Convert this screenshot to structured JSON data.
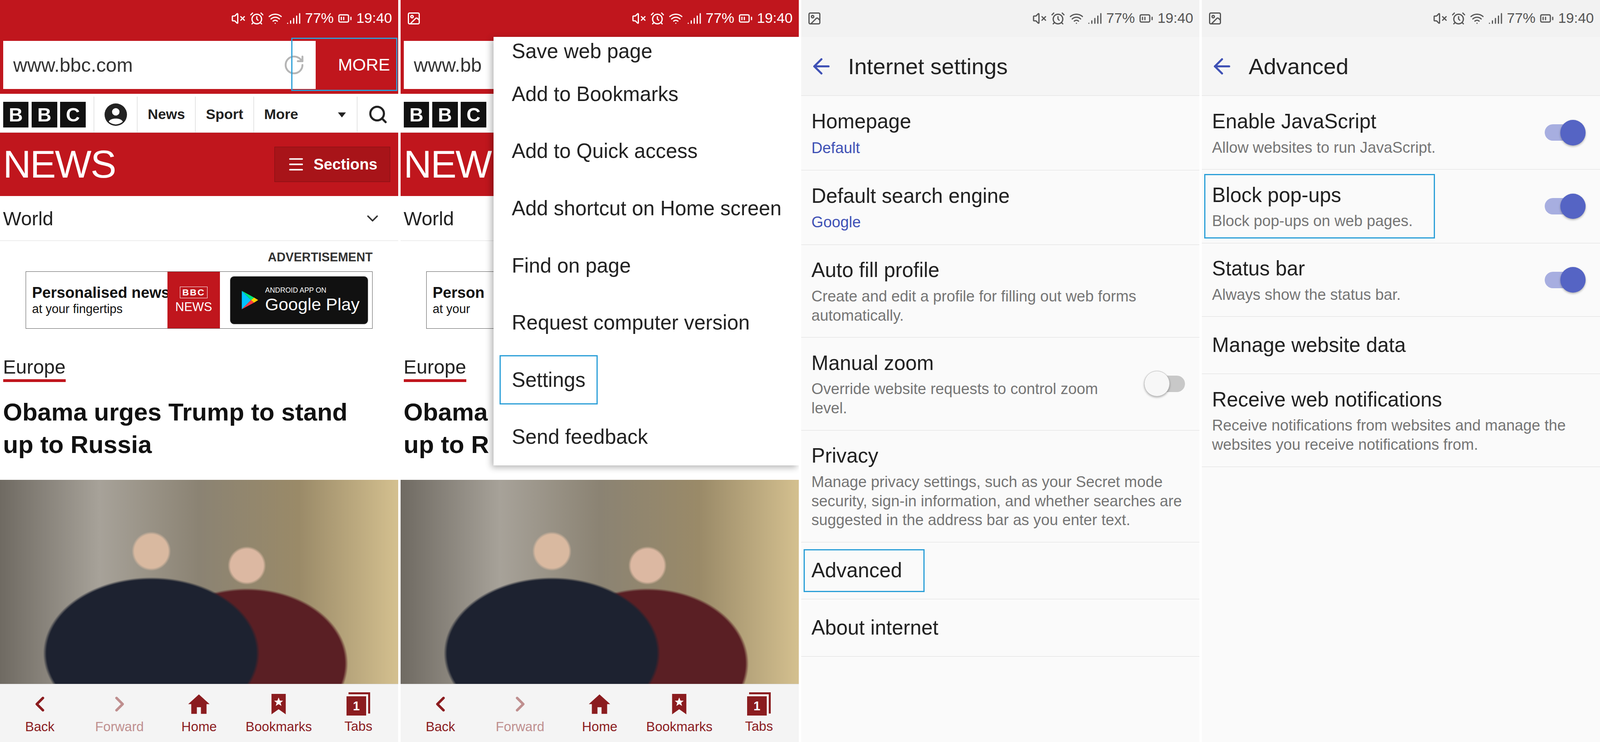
{
  "panels": [
    {
      "kind": "browser",
      "status": {
        "battery": "77%",
        "time": "19:40",
        "notification": false
      },
      "url": "www.bbc.com",
      "more": {
        "label": "MORE",
        "highlighted": true
      },
      "logo": [
        "B",
        "B",
        "C"
      ],
      "nav_links": [
        "News",
        "Sport",
        "More"
      ],
      "band": {
        "title": "NEWS",
        "button": "Sections"
      },
      "region": "World",
      "ad": {
        "label": "ADVERTISEMENT",
        "line1": "Personalised news",
        "line2": "at your fingertips",
        "brand": [
          "BBC",
          "NEWS"
        ],
        "store_small": "ANDROID APP ON",
        "store": "Google Play"
      },
      "category": "Europe",
      "headline": [
        "Obama urges Trump to stand",
        "up to Russia"
      ],
      "bottom_nav": [
        {
          "kind": "back",
          "label": "Back",
          "disabled": false
        },
        {
          "kind": "forward",
          "label": "Forward",
          "disabled": true
        },
        {
          "kind": "home",
          "label": "Home",
          "disabled": false
        },
        {
          "kind": "bookmarks",
          "label": "Bookmarks",
          "disabled": false
        },
        {
          "kind": "tabs",
          "label": "Tabs",
          "badge": "1",
          "disabled": false
        }
      ]
    },
    {
      "kind": "browser-menu",
      "status": {
        "battery": "77%",
        "time": "19:40",
        "notification": true
      },
      "url": "www.bb",
      "logo": [
        "B",
        "B",
        "C"
      ],
      "band": {
        "title": "NEW"
      },
      "region": "World",
      "ad": {
        "line1": "Person",
        "line2": "at your"
      },
      "category": "Europe",
      "headline": [
        "Obama",
        "up to R"
      ],
      "menu": [
        {
          "label": "Save web page",
          "highlighted": false
        },
        {
          "label": "Add to Bookmarks",
          "highlighted": false
        },
        {
          "label": "Add to Quick access",
          "highlighted": false
        },
        {
          "label": "Add shortcut on Home screen",
          "highlighted": false
        },
        {
          "label": "Find on page",
          "highlighted": false
        },
        {
          "label": "Request computer version",
          "highlighted": false
        },
        {
          "label": "Settings",
          "highlighted": true
        },
        {
          "label": "Send feedback",
          "highlighted": false
        }
      ],
      "bottom_nav": [
        {
          "kind": "back",
          "label": "Back",
          "disabled": false
        },
        {
          "kind": "forward",
          "label": "Forward",
          "disabled": true
        },
        {
          "kind": "home",
          "label": "Home",
          "disabled": false
        },
        {
          "kind": "bookmarks",
          "label": "Bookmarks",
          "disabled": false
        },
        {
          "kind": "tabs",
          "label": "Tabs",
          "badge": "1",
          "disabled": false
        }
      ]
    },
    {
      "kind": "settings",
      "status": {
        "battery": "77%",
        "time": "19:40",
        "notification": true
      },
      "title": "Internet settings",
      "items": [
        {
          "kind": "value",
          "title": "Homepage",
          "value": "Default",
          "highlighted": false
        },
        {
          "kind": "value",
          "title": "Default search engine",
          "value": "Google",
          "highlighted": false
        },
        {
          "kind": "description",
          "title": "Auto fill profile",
          "description": "Create and edit a profile for filling out web forms automatically.",
          "highlighted": false
        },
        {
          "kind": "toggle",
          "title": "Manual zoom",
          "description": "Override website requests to control zoom level.",
          "on": false,
          "highlighted": false
        },
        {
          "kind": "description",
          "title": "Privacy",
          "description": "Manage privacy settings, such as your Secret mode security, sign-in information, and whether searches are suggested in the address bar as you enter text.",
          "highlighted": false
        },
        {
          "kind": "plain",
          "title": "Advanced",
          "highlighted": true
        },
        {
          "kind": "plain",
          "title": "About internet",
          "highlighted": false
        }
      ]
    },
    {
      "kind": "settings",
      "status": {
        "battery": "77%",
        "time": "19:40",
        "notification": true
      },
      "title": "Advanced",
      "items": [
        {
          "kind": "toggle",
          "title": "Enable JavaScript",
          "description": "Allow websites to run JavaScript.",
          "on": true,
          "highlighted": false
        },
        {
          "kind": "toggle",
          "title": "Block pop-ups",
          "description": "Block pop-ups on web pages.",
          "on": true,
          "highlighted": true
        },
        {
          "kind": "toggle",
          "title": "Status bar",
          "description": "Always show the status bar.",
          "on": true,
          "highlighted": false
        },
        {
          "kind": "plain",
          "title": "Manage website data",
          "highlighted": false
        },
        {
          "kind": "description",
          "title": "Receive web notifications",
          "description": "Receive notifications from websites and manage the websites you receive notifications from.",
          "highlighted": false
        }
      ]
    }
  ]
}
